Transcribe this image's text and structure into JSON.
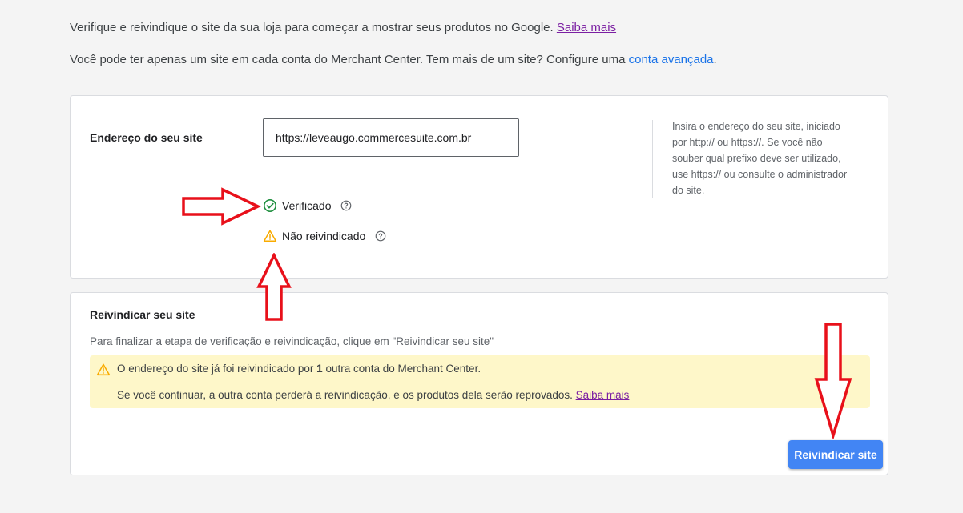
{
  "intro": {
    "line1_text": "Verifique e reivindique o site da sua loja para começar a mostrar seus produtos no Google.",
    "line1_link": "Saiba mais",
    "line2_text": "Você pode ter apenas um site em cada conta do Merchant Center. Tem mais de um site? Configure uma",
    "line2_link": "conta avançada",
    "line2_end": "."
  },
  "site_card": {
    "label": "Endereço do seu site",
    "url_value": "https://leveaugo.commercesuite.com.br",
    "help_text": "Insira o endereço do seu site, iniciado por http:// ou https://. Se você não souber qual prefixo deve ser utilizado, use https:// ou consulte o administrador do site.",
    "status_verified": "Verificado",
    "status_unclaimed": "Não reivindicado"
  },
  "claim_card": {
    "title": "Reivindicar seu site",
    "description": "Para finalizar a etapa de verificação e reivindicação, clique em \"Reivindicar seu site\"",
    "warning_line1_pre": "O endereço do site já foi reivindicado por",
    "warning_line1_count": "1",
    "warning_line1_post": "outra conta do Merchant Center.",
    "warning_line2": "Se você continuar, a outra conta perderá a reivindicação, e os produtos dela serão reprovados.",
    "warning_link": "Saiba mais",
    "button_label": "Reivindicar site"
  },
  "icons": {
    "verified": "check-circle-icon",
    "warning": "warning-triangle-icon",
    "help": "help-circle-icon",
    "annotation": "red-arrow-icon"
  },
  "colors": {
    "verified_green": "#1e8e3e",
    "warning_yellow": "#f9ab00",
    "button_blue": "#4285f4",
    "link_purple": "#7b1fa2",
    "link_blue": "#1a73e8",
    "warning_bg": "#fef7c9",
    "annotation_red": "#e8101a"
  }
}
